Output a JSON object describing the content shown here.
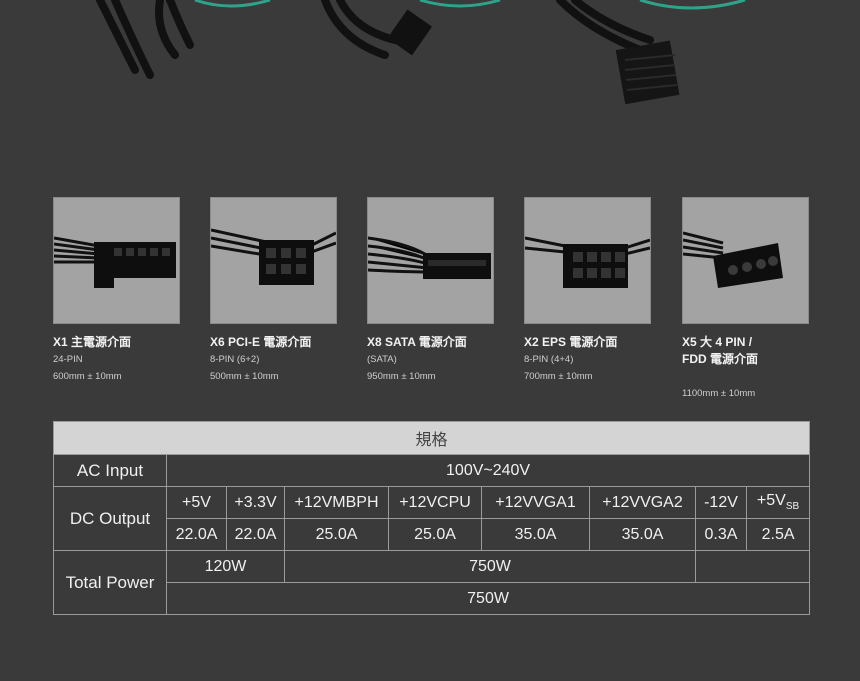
{
  "cables": [
    {
      "title": "X1 主電源介面",
      "line1": "24-PIN",
      "line2": "600mm ± 10mm",
      "line3": ""
    },
    {
      "title": "X6 PCI-E 電源介面",
      "line1": "8-PIN (6+2)",
      "line2": "500mm ± 10mm",
      "line3": ""
    },
    {
      "title": "X8 SATA 電源介面",
      "line1": "(SATA)",
      "line2": "950mm ± 10mm",
      "line3": ""
    },
    {
      "title": "X2 EPS 電源介面",
      "line1": "8-PIN (4+4)",
      "line2": "700mm ± 10mm",
      "line3": ""
    },
    {
      "title": "X5 大 4 PIN /",
      "line1": "FDD 電源介面",
      "line2": "",
      "line3": "1100mm ± 10mm"
    }
  ],
  "spec": {
    "header": "規格",
    "ac_label": "AC Input",
    "ac_value": "100V~240V",
    "dc_label": "DC Output",
    "rails": [
      "+5V",
      "+3.3V",
      "+12VMBPH",
      "+12VCPU",
      "+12VVGA1",
      "+12VVGA2",
      "-12V",
      "+5V"
    ],
    "rail_last_sub": "SB",
    "currents": [
      "22.0A",
      "22.0A",
      "25.0A",
      "25.0A",
      "35.0A",
      "35.0A",
      "0.3A",
      "2.5A"
    ],
    "total_label": "Total Power",
    "total_120": "120W",
    "total_12v": "750W",
    "total_all": "750W"
  },
  "colors": {
    "background": "#3a3a3a",
    "photo_bg": "#a3a3a3",
    "header_bg": "#d4d4d4",
    "accent_ring": "#2fa38a"
  }
}
